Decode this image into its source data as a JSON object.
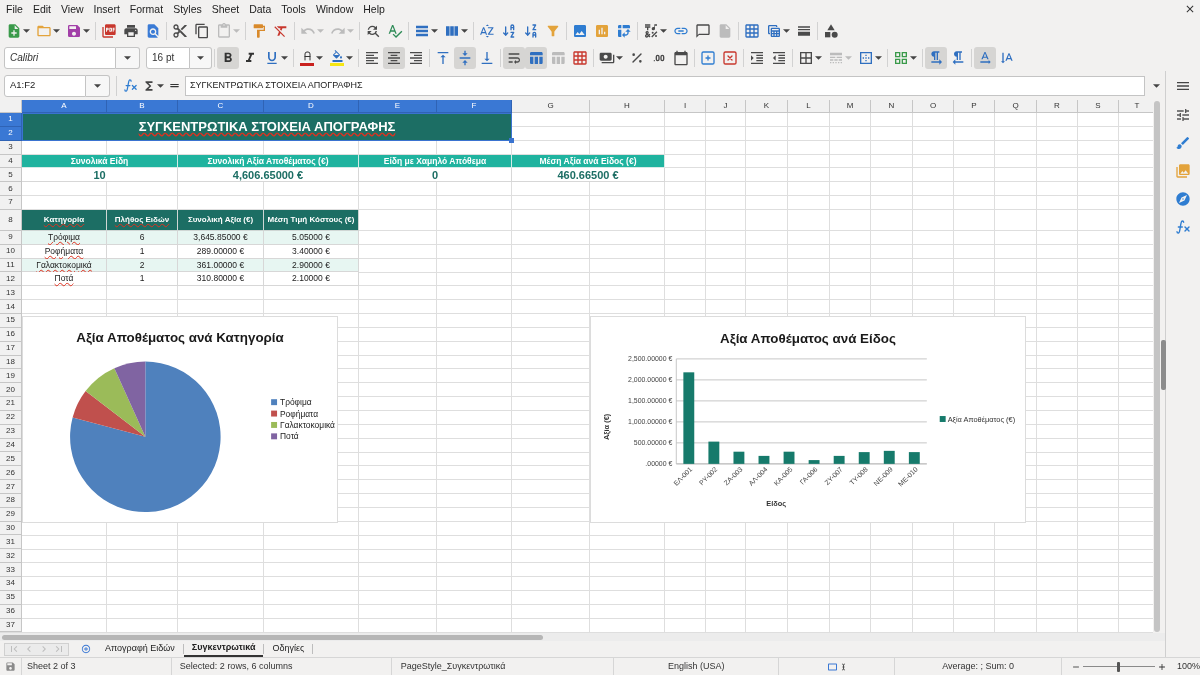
{
  "menu_bar": {
    "items": [
      "File",
      "Edit",
      "View",
      "Insert",
      "Format",
      "Styles",
      "Sheet",
      "Data",
      "Tools",
      "Window",
      "Help"
    ]
  },
  "standard_toolbar": {
    "groups": [
      [
        {
          "kind": "new",
          "disabled": false
        },
        {
          "kind": "open",
          "disabled": false
        },
        {
          "kind": "save",
          "disabled": false
        }
      ],
      [
        {
          "kind": "export_pdf",
          "disabled": false
        },
        {
          "kind": "print",
          "disabled": false
        },
        {
          "kind": "print_preview",
          "disabled": false
        }
      ],
      [
        {
          "kind": "cut",
          "disabled": false
        },
        {
          "kind": "copy",
          "disabled": false
        },
        {
          "kind": "paste",
          "disabled": true
        }
      ],
      [
        {
          "kind": "clone_formatting",
          "disabled": false
        },
        {
          "kind": "clear_formatting",
          "disabled": false
        }
      ],
      [
        {
          "kind": "undo",
          "disabled": true
        },
        {
          "kind": "redo",
          "disabled": true
        }
      ],
      [
        {
          "kind": "find_replace",
          "disabled": false
        },
        {
          "kind": "spelling",
          "disabled": false
        }
      ],
      [
        {
          "kind": "row",
          "disabled": false
        },
        {
          "kind": "column",
          "disabled": false
        }
      ],
      [
        {
          "kind": "sort",
          "disabled": false
        },
        {
          "kind": "sort_ascending",
          "disabled": false
        },
        {
          "kind": "sort_descending",
          "disabled": false
        },
        {
          "kind": "autofilter",
          "disabled": false
        }
      ],
      [
        {
          "kind": "image",
          "disabled": false
        },
        {
          "kind": "chart",
          "disabled": false
        },
        {
          "kind": "pivot_table",
          "disabled": false
        }
      ],
      [
        {
          "kind": "special_character",
          "disabled": false
        },
        {
          "kind": "hyperlink",
          "disabled": false
        },
        {
          "kind": "comment",
          "disabled": false
        },
        {
          "kind": "headers_footers",
          "disabled": true
        }
      ],
      [
        {
          "kind": "print_area",
          "disabled": false
        },
        {
          "kind": "freeze",
          "disabled": false
        },
        {
          "kind": "split_window",
          "disabled": false
        }
      ],
      [
        {
          "kind": "shapes",
          "disabled": false
        }
      ]
    ]
  },
  "formatting_toolbar": {
    "font_name": "Calibri",
    "font_size": "16 pt",
    "groups": [
      [
        {
          "kind": "bold",
          "active": true,
          "disabled": false
        },
        {
          "kind": "italic",
          "active": false,
          "disabled": false
        },
        {
          "kind": "underline",
          "active": false,
          "disabled": false
        }
      ],
      [
        {
          "kind": "font_color",
          "active": false,
          "disabled": false
        },
        {
          "kind": "highlight",
          "active": false,
          "disabled": false
        }
      ],
      [
        {
          "kind": "align_left",
          "active": false,
          "disabled": false
        },
        {
          "kind": "align_center",
          "active": true,
          "disabled": false
        },
        {
          "kind": "align_right",
          "active": false,
          "disabled": false
        }
      ],
      [
        {
          "kind": "align_top",
          "active": false,
          "disabled": false
        },
        {
          "kind": "align_middle",
          "active": true,
          "disabled": false
        },
        {
          "kind": "align_bottom",
          "active": false,
          "disabled": false
        }
      ],
      [
        {
          "kind": "wrap_text",
          "active": true,
          "disabled": false
        },
        {
          "kind": "merge_center",
          "active": true,
          "disabled": false
        },
        {
          "kind": "merge",
          "active": false,
          "disabled": true
        },
        {
          "kind": "unmerge",
          "active": false,
          "disabled": false
        }
      ],
      [
        {
          "kind": "currency",
          "active": false,
          "disabled": false
        },
        {
          "kind": "percent",
          "active": false,
          "disabled": false
        },
        {
          "kind": "number",
          "active": false,
          "disabled": false
        },
        {
          "kind": "date",
          "active": false,
          "disabled": false
        }
      ],
      [
        {
          "kind": "add_decimal",
          "active": false,
          "disabled": false
        },
        {
          "kind": "delete_decimal",
          "active": false,
          "disabled": false
        }
      ],
      [
        {
          "kind": "indent",
          "active": false,
          "disabled": false
        },
        {
          "kind": "outdent",
          "active": false,
          "disabled": false
        }
      ],
      [
        {
          "kind": "borders",
          "active": false,
          "disabled": false
        },
        {
          "kind": "border_style",
          "active": false,
          "disabled": true
        },
        {
          "kind": "border_color",
          "active": false,
          "disabled": false
        }
      ],
      [
        {
          "kind": "conditional",
          "active": false,
          "disabled": false
        }
      ],
      [
        {
          "kind": "ltr",
          "active": true,
          "disabled": false
        },
        {
          "kind": "rtl",
          "active": false,
          "disabled": false
        }
      ],
      [
        {
          "kind": "text_ltr",
          "active": true,
          "disabled": false
        },
        {
          "kind": "text_ttb",
          "active": false,
          "disabled": false
        }
      ]
    ]
  },
  "formula_bar": {
    "name_box": "A1:F2",
    "content": "ΣΥΓΚΕΝΤΡΩΤΙΚΑ ΣΤΟΙΧΕΙΑ ΑΠΟΓΡΑΦΗΣ"
  },
  "sheet": {
    "columns": [
      {
        "label": "A",
        "selected": true
      },
      {
        "label": "B",
        "selected": true
      },
      {
        "label": "C",
        "selected": true
      },
      {
        "label": "D",
        "selected": true
      },
      {
        "label": "E",
        "selected": true
      },
      {
        "label": "F",
        "selected": true
      },
      {
        "label": "G",
        "selected": false
      },
      {
        "label": "H",
        "selected": false
      },
      {
        "label": "I",
        "selected": false
      },
      {
        "label": "J",
        "selected": false
      },
      {
        "label": "K",
        "selected": false
      },
      {
        "label": "L",
        "selected": false
      },
      {
        "label": "M",
        "selected": false
      },
      {
        "label": "N",
        "selected": false
      },
      {
        "label": "O",
        "selected": false
      },
      {
        "label": "P",
        "selected": false
      },
      {
        "label": "Q",
        "selected": false
      },
      {
        "label": "R",
        "selected": false
      },
      {
        "label": "S",
        "selected": false
      },
      {
        "label": "T",
        "selected": false
      }
    ],
    "rows": [
      {
        "label": "1",
        "selected": true
      },
      {
        "label": "2",
        "selected": true
      },
      {
        "label": "3",
        "selected": false
      },
      {
        "label": "4",
        "selected": false
      },
      {
        "label": "5",
        "selected": false
      },
      {
        "label": "6",
        "selected": false
      },
      {
        "label": "7",
        "selected": false
      },
      {
        "label": "8",
        "selected": false
      },
      {
        "label": "9",
        "selected": false
      },
      {
        "label": "10",
        "selected": false
      },
      {
        "label": "11",
        "selected": false
      },
      {
        "label": "12",
        "selected": false
      },
      {
        "label": "13",
        "selected": false
      },
      {
        "label": "14",
        "selected": false
      },
      {
        "label": "15",
        "selected": false
      },
      {
        "label": "16",
        "selected": false
      },
      {
        "label": "17",
        "selected": false
      },
      {
        "label": "18",
        "selected": false
      },
      {
        "label": "19",
        "selected": false
      },
      {
        "label": "20",
        "selected": false
      },
      {
        "label": "21",
        "selected": false
      },
      {
        "label": "22",
        "selected": false
      },
      {
        "label": "23",
        "selected": false
      },
      {
        "label": "24",
        "selected": false
      },
      {
        "label": "25",
        "selected": false
      },
      {
        "label": "26",
        "selected": false
      },
      {
        "label": "27",
        "selected": false
      },
      {
        "label": "28",
        "selected": false
      },
      {
        "label": "29",
        "selected": false
      },
      {
        "label": "30",
        "selected": false
      },
      {
        "label": "31",
        "selected": false
      },
      {
        "label": "32",
        "selected": false
      },
      {
        "label": "33",
        "selected": false
      },
      {
        "label": "34",
        "selected": false
      },
      {
        "label": "35",
        "selected": false
      },
      {
        "label": "36",
        "selected": false
      },
      {
        "label": "37",
        "selected": false
      }
    ],
    "title": {
      "text": "ΣΥΓΚΕΝΤΡΩΤΙΚΑ ΣΤΟΙΧΕΙΑ ΑΠΟΓΡΑΦΗΣ",
      "misspelled": true
    },
    "summary": [
      {
        "label": "Συνολικά Είδη",
        "value": "10"
      },
      {
        "label": "Συνολική Αξία Αποθέματος (€)",
        "value": "4,606.65000 €"
      },
      {
        "label": "Είδη με Χαμηλό Απόθεμα",
        "value": "0"
      },
      {
        "label": "Μέση Αξία ανά Είδος (€)",
        "value": "460.66500 €"
      }
    ],
    "category_table": {
      "columns": [
        {
          "label": "Κατηγορία",
          "misspelled": true
        },
        {
          "label": "Πλήθος Ειδών",
          "misspelled": true
        },
        {
          "label": "Συνολική Αξία (€)",
          "misspelled": false
        },
        {
          "label": "Μέση Τιμή Κόστους (€)",
          "misspelled": false
        }
      ],
      "rows": [
        {
          "category": "Τρόφιμα",
          "misspelled": true,
          "count": "6",
          "total": "3,645.85000 €",
          "average": "5.05000 €"
        },
        {
          "category": "Ροφήματα",
          "misspelled": true,
          "count": "1",
          "total": "289.00000 €",
          "average": "3.40000 €"
        },
        {
          "category": "Γαλακτοκομικά",
          "misspelled": true,
          "count": "2",
          "total": "361.00000 €",
          "average": "2.90000 €"
        },
        {
          "category": "Ποτά",
          "misspelled": true,
          "count": "1",
          "total": "310.80000 €",
          "average": "2.10000 €"
        }
      ]
    },
    "pie_chart": {
      "chart_data": {
        "type": "pie",
        "title": "Αξία Αποθέματος ανά Κατηγορία",
        "categories": [
          "Τρόφιμα",
          "Ροφήματα",
          "Γαλακτοκομικά",
          "Ποτά"
        ],
        "values": [
          79.14,
          6.27,
          7.84,
          6.75
        ],
        "colors": [
          "#4f81bd",
          "#c0504d",
          "#9bbb59",
          "#8064a2"
        ],
        "legend": "right"
      }
    },
    "bar_chart": {
      "chart_data": {
        "type": "bar",
        "title": "Αξία Αποθέματος ανά Είδος",
        "xlabel": "Είδος",
        "ylabel": "Αξία (€)",
        "categories": [
          "ΕΛ-001",
          "ΡΥ-002",
          "ΖΑ-003",
          "ΑΛ-004",
          "ΚΑ-005",
          "ΓΑ-006",
          "ΖΥ-007",
          "ΤΥ-008",
          "ΝΕ-009",
          "ΜΕ-010"
        ],
        "series": [
          {
            "name": "Αξία Αποθέματος (€)",
            "color": "#167a6b",
            "values": [
              2180,
              530,
              290,
              190,
              290,
              90,
              190,
              280,
              310,
              280
            ]
          }
        ],
        "ylim": [
          0,
          2500
        ],
        "yticks": [
          {
            "value": 0,
            "label": ".00000 €"
          },
          {
            "value": 500,
            "label": "500.00000 €"
          },
          {
            "value": 1000,
            "label": "1,000.00000 €"
          },
          {
            "value": 1500,
            "label": "1,500.00000 €"
          },
          {
            "value": 2000,
            "label": "2,000.00000 €"
          },
          {
            "value": 2500,
            "label": "2,500.00000 €"
          }
        ],
        "grid": true,
        "legend": "right"
      }
    }
  },
  "sheet_tabs": [
    {
      "label": "Απογραφή Ειδών",
      "selected": false
    },
    {
      "label": "Συγκεντρωτικά",
      "selected": true
    },
    {
      "label": "Οδηγίες",
      "selected": false
    }
  ],
  "status_bar": {
    "sheet_position": "Sheet 2 of 3",
    "selection": "Selected: 2 rows, 6 columns",
    "page_style": "PageStyle_Συγκεντρωτικά",
    "language": "English (USA)",
    "statistics": "Average: ; Sum: 0",
    "zoom": {
      "label": "100%",
      "level": 0.5
    }
  }
}
